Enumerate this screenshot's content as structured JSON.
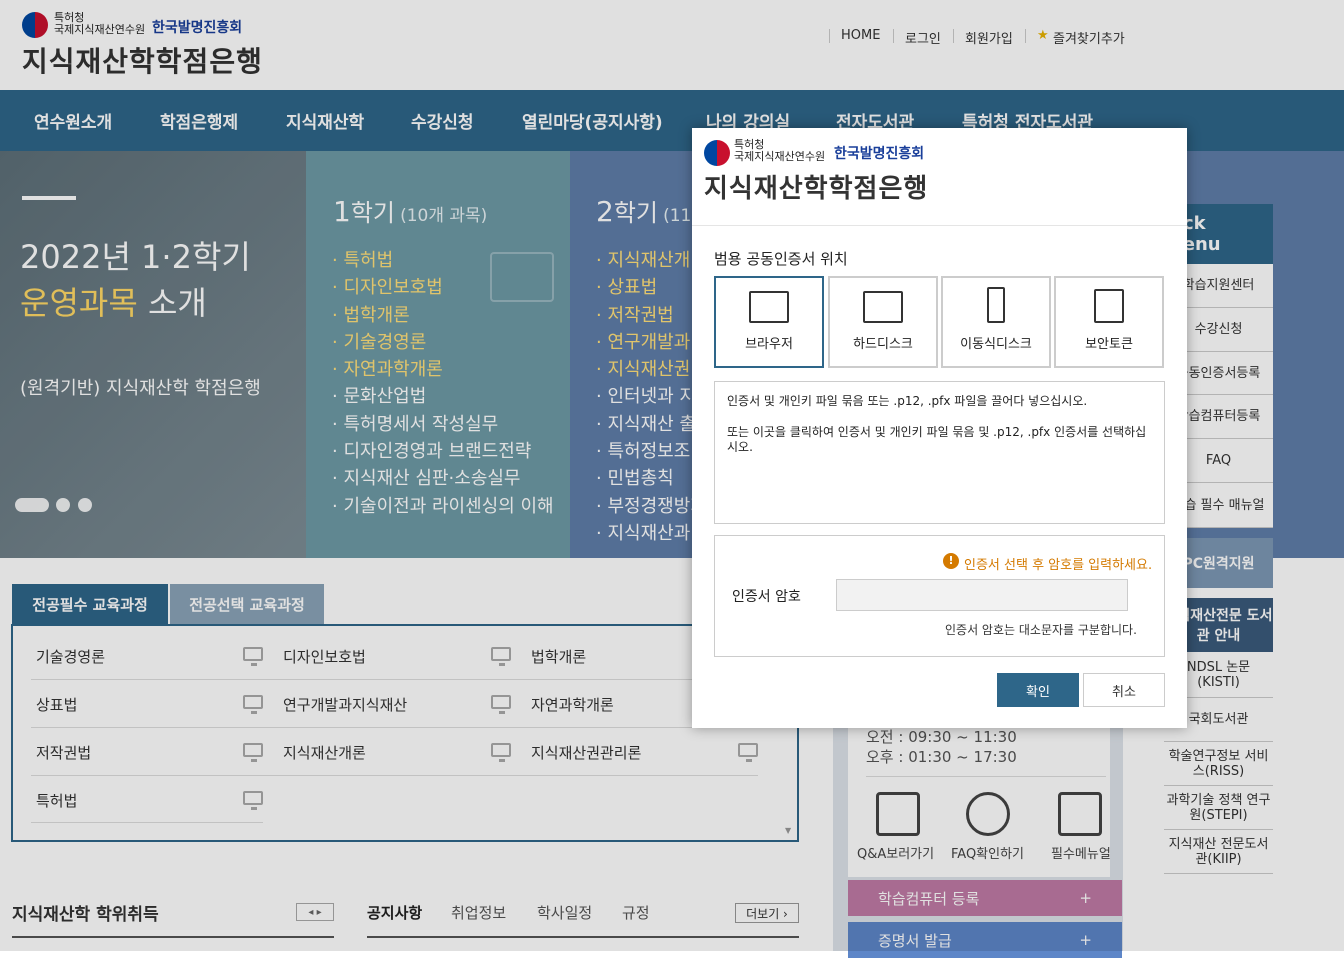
{
  "header": {
    "org_line1": "특허청",
    "org_line2": "국제지식재산연수원",
    "partner": "한국발명진흥회",
    "site_title": "지식재산학학점은행",
    "util": {
      "home": "HOME",
      "login": "로그인",
      "join": "회원가입",
      "bookmark": "즐겨찾기추가"
    }
  },
  "nav": {
    "items": [
      "연수원소개",
      "학점은행제",
      "지식재산학",
      "수강신청",
      "열린마당(공지사항)",
      "나의 강의실",
      "전자도서관",
      "특허청 전자도서관"
    ]
  },
  "hero": {
    "title1": "2022년 1·2학기",
    "title2_highlight": "운영과목",
    "title2_rest": " 소개",
    "subtitle": "(원격기반) 지식재산학 학점은행",
    "semester1": {
      "num": "1",
      "label": "학기",
      "count": "(10개 과목)",
      "courses": [
        "특허법",
        "디자인보호법",
        "법학개론",
        "기술경영론",
        "자연과학개론",
        "문화산업법",
        "특허명세서 작성실무",
        "디자인경영과 브랜드전략",
        "지식재산 심판·소송실무",
        "기술이전과 라이센싱의 이해"
      ]
    },
    "semester2": {
      "num": "2",
      "label": "학기",
      "count": "(11",
      "courses": [
        "지식재산개",
        "상표법",
        "저작권법",
        "연구개발과",
        "지식재산권",
        "인터넷과 지",
        "지식재산 출",
        "특허정보조",
        "민법총칙",
        "부정경쟁방지",
        "지식재산과"
      ]
    }
  },
  "course_tabs": {
    "major_required": "전공필수 교육과정",
    "major_elective": "전공선택 교육과정"
  },
  "courses": [
    [
      "기술경영론",
      "디자인보호법",
      "법학개론"
    ],
    [
      "상표법",
      "연구개발과지식재산",
      "자연과학개론"
    ],
    [
      "저작권법",
      "지식재산개론",
      "지식재산권관리론"
    ],
    [
      "특허법",
      "",
      ""
    ]
  ],
  "bottom": {
    "degree_title": "지식재산학 학위취득",
    "notice_tabs": [
      "공지사항",
      "취업정보",
      "학사일정",
      "규정"
    ],
    "more": "더보기 ›",
    "arrows": "◂ ▸"
  },
  "schedule": {
    "am": "오전 : 09:30 ~ 11:30",
    "pm": "오후 : 01:30 ~ 17:30",
    "services": [
      "Q&A보러가기",
      "FAQ확인하기",
      "필수메뉴얼"
    ],
    "register_pc": "학습컴퓨터 등록",
    "certificate": "증명서 발급",
    "plus": "+"
  },
  "quick_menu": {
    "head": "uick menu",
    "items": [
      "학습지원센터",
      "수강신청",
      "공동인증서등록",
      "학습컴퓨터등록",
      "FAQ",
      "학습 필수 매뉴얼"
    ],
    "remote": "PC원격지원",
    "library_head": "지식재산전문 도서관 안내",
    "libraries": [
      "NDSL 논문 (KISTI)",
      "국회도서관",
      "학술연구정보 서비스(RISS)",
      "과학기술 정책 연구원(STEPI)",
      "지식재산 전문도서관(KIIP)"
    ]
  },
  "dialog": {
    "org_line1": "특허청",
    "org_line2": "국제지식재산연수원",
    "partner": "한국발명진흥회",
    "title": "지식재산학학점은행",
    "location_label": "범용 공동인증서 위치",
    "locations": [
      "브라우저",
      "하드디스크",
      "이동식디스크",
      "보안토큰"
    ],
    "drop_text1": "인증서 및 개인키 파일 묶음 또는 .p12, .pfx 파일을 끌어다 넣으십시오.",
    "drop_text2": "또는 이곳을 클릭하여 인증서 및 개인키 파일 묶음 및 .p12, .pfx 인증서를 선택하십시오.",
    "warning": "인증서 선택 후 암호를 입력하세요.",
    "password_label": "인증서 암호",
    "password_value": "",
    "case_note": "인증서 암호는 대소문자를 구분합니다.",
    "ok": "확인",
    "cancel": "취소"
  },
  "colors": {
    "brand": "#2e6689",
    "highlight": "#ffe07a",
    "warning": "#d47a00"
  }
}
